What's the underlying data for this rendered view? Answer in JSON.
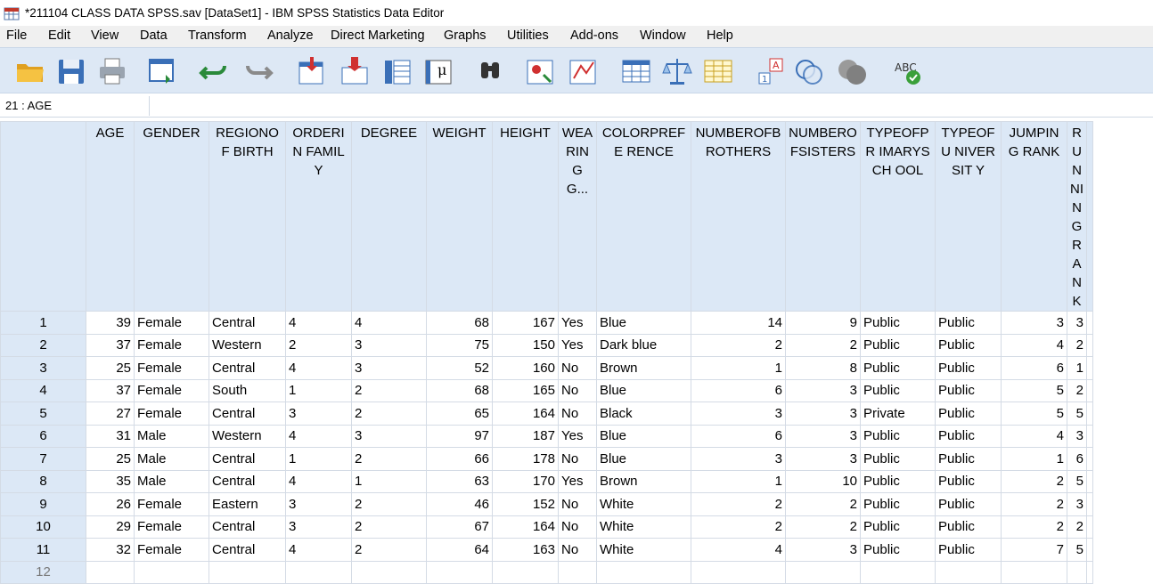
{
  "window": {
    "title": "*211104 CLASS DATA SPSS.sav [DataSet1] - IBM SPSS Statistics Data Editor"
  },
  "menu": [
    "File",
    "Edit",
    "View",
    "Data",
    "Transform",
    "Analyze",
    "Direct Marketing",
    "Graphs",
    "Utilities",
    "Add-ons",
    "Window",
    "Help"
  ],
  "toolbar_icons": [
    "open-folder-icon",
    "save-icon",
    "print-icon",
    "dialog-recall-icon",
    "undo-icon",
    "redo-icon",
    "goto-case-icon",
    "goto-variable-icon",
    "variables-icon",
    "run-descriptives-icon",
    "find-icon",
    "insert-cases-icon",
    "insert-variable-icon",
    "split-file-icon",
    "weight-cases-icon",
    "select-cases-icon",
    "value-labels-icon",
    "use-sets-icon",
    "show-all-variables-icon",
    "spell-check-icon"
  ],
  "cell_reference": "21 : AGE",
  "columns": [
    "AGE",
    "GENDER",
    "REGIONOFBIRTH",
    "ORDERINFAMILY",
    "DEGREE",
    "WEIGHT",
    "HEIGHT",
    "WEARINGG...",
    "COLORPREFERENCE",
    "NUMBEROFBROTHERS",
    "NUMBEROFSISTERS",
    "TYPEOFPRIMARYSCHOOL",
    "TYPEOFUNIVERSITY",
    "JUMPINGRANK",
    "RUNNINGRANK"
  ],
  "column_headers_display": [
    "AGE",
    "GENDER",
    "REGIONOF BIRTH",
    "ORDERIN FAMILY",
    "DEGREE",
    "WEIGHT",
    "HEIGHT",
    "WEA RING G...",
    "COLORPREFE RENCE",
    "NUMBEROFB ROTHERS",
    "NUMBERO FSISTERS",
    "TYPEOFPR IMARYSCH OOL",
    "TYPEOFU NIVERSIT Y",
    "JUMPING RANK",
    "RUNNING RANK"
  ],
  "rows": [
    {
      "n": "1",
      "cells": [
        "39",
        "Female",
        "Central",
        "4",
        "4",
        "68",
        "167",
        "Yes",
        "Blue",
        "14",
        "9",
        "Public",
        "Public",
        "3",
        "3"
      ]
    },
    {
      "n": "2",
      "cells": [
        "37",
        "Female",
        "Western",
        "2",
        "3",
        "75",
        "150",
        "Yes",
        "Dark blue",
        "2",
        "2",
        "Public",
        "Public",
        "4",
        "2"
      ]
    },
    {
      "n": "3",
      "cells": [
        "25",
        "Female",
        "Central",
        "4",
        "3",
        "52",
        "160",
        "No",
        "Brown",
        "1",
        "8",
        "Public",
        "Public",
        "6",
        "1"
      ]
    },
    {
      "n": "4",
      "cells": [
        "37",
        "Female",
        "South",
        "1",
        "2",
        "68",
        "165",
        "No",
        "Blue",
        "6",
        "3",
        "Public",
        "Public",
        "5",
        "2"
      ]
    },
    {
      "n": "5",
      "cells": [
        "27",
        "Female",
        "Central",
        "3",
        "2",
        "65",
        "164",
        "No",
        "Black",
        "3",
        "3",
        "Private",
        "Public",
        "5",
        "5"
      ]
    },
    {
      "n": "6",
      "cells": [
        "31",
        "Male",
        "Western",
        "4",
        "3",
        "97",
        "187",
        "Yes",
        "Blue",
        "6",
        "3",
        "Public",
        "Public",
        "4",
        "3"
      ]
    },
    {
      "n": "7",
      "cells": [
        "25",
        "Male",
        "Central",
        "1",
        "2",
        "66",
        "178",
        "No",
        "Blue",
        "3",
        "3",
        "Public",
        "Public",
        "1",
        "6"
      ]
    },
    {
      "n": "8",
      "cells": [
        "35",
        "Male",
        "Central",
        "4",
        "1",
        "63",
        "170",
        "Yes",
        "Brown",
        "1",
        "10",
        "Public",
        "Public",
        "2",
        "5"
      ]
    },
    {
      "n": "9",
      "cells": [
        "26",
        "Female",
        "Eastern",
        "3",
        "2",
        "46",
        "152",
        "No",
        "White",
        "2",
        "2",
        "Public",
        "Public",
        "2",
        "3"
      ]
    },
    {
      "n": "10",
      "cells": [
        "29",
        "Female",
        "Central",
        "3",
        "2",
        "67",
        "164",
        "No",
        "White",
        "2",
        "2",
        "Public",
        "Public",
        "2",
        "2"
      ]
    },
    {
      "n": "11",
      "cells": [
        "32",
        "Female",
        "Central",
        "4",
        "2",
        "64",
        "163",
        "No",
        "White",
        "4",
        "3",
        "Public",
        "Public",
        "7",
        "5"
      ]
    }
  ],
  "empty_row_number": "12",
  "colors": {
    "toolbar_bg": "#dde8f5",
    "header_bg": "#dce8f6",
    "menubar_bg": "#f0f0f0",
    "grid_line": "#d4dbe5"
  }
}
